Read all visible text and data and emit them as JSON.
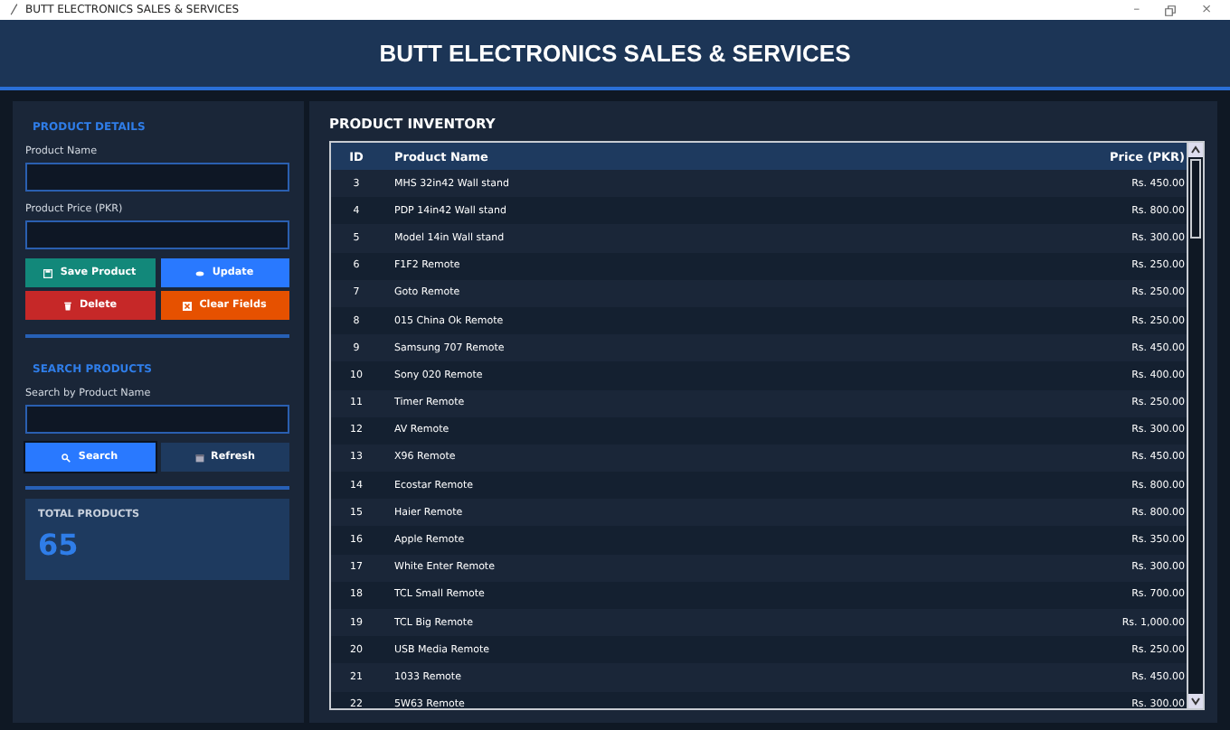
{
  "window": {
    "title": "BUTT ELECTRONICS SALES & SERVICES",
    "controls": [
      "–",
      "×"
    ]
  },
  "header": {
    "title": "BUTT ELECTRONICS SALES & SERVICES"
  },
  "product_details": {
    "title": "PRODUCT DETAILS",
    "fields": [
      {
        "label": "Product Name"
      },
      {
        "label": "Product Price (PKR)"
      }
    ],
    "buttons": [
      {
        "label": "Save Product",
        "kind": "save"
      },
      {
        "label": "Update",
        "kind": "update"
      },
      {
        "label": "Delete",
        "kind": "delete"
      },
      {
        "label": "Clear Fields",
        "kind": "clear"
      }
    ]
  },
  "search_products": {
    "title": "SEARCH PRODUCTS",
    "field": {
      "label": "Search by Product Name"
    },
    "buttons": [
      {
        "label": "Search",
        "kind": "search"
      },
      {
        "label": "Refresh",
        "kind": "refresh"
      }
    ]
  },
  "total_products": {
    "label": "TOTAL PRODUCTS",
    "value": "65"
  },
  "inventory": {
    "title": "PRODUCT INVENTORY",
    "columns": [
      "ID",
      "Product Name",
      "Price (PKR)"
    ],
    "rows": [
      [
        "3",
        "MHS 32in42 Wall stand",
        "Rs. 450.00"
      ],
      [
        "4",
        "PDP 14in42 Wall stand",
        "Rs. 800.00"
      ],
      [
        "5",
        "Model 14in Wall stand",
        "Rs. 300.00"
      ],
      [
        "6",
        "F1F2 Remote",
        "Rs. 250.00"
      ],
      [
        "7",
        "Goto Remote",
        "Rs. 250.00"
      ],
      [
        "8",
        "015 China Ok Remote",
        "Rs. 250.00"
      ],
      [
        "9",
        "Samsung 707 Remote",
        "Rs. 450.00"
      ],
      [
        "10",
        "Sony 020 Remote",
        "Rs. 400.00"
      ],
      [
        "11",
        "Timer Remote",
        "Rs. 250.00"
      ],
      [
        "12",
        "AV Remote",
        "Rs. 300.00"
      ],
      [
        "13",
        "X96 Remote",
        "Rs. 450.00"
      ],
      [
        "14",
        "Ecostar Remote",
        "Rs. 800.00"
      ],
      [
        "15",
        "Haier Remote",
        "Rs. 800.00"
      ],
      [
        "16",
        "Apple Remote",
        "Rs. 350.00"
      ],
      [
        "17",
        "White Enter Remote",
        "Rs. 300.00"
      ],
      [
        "18",
        "TCL Small Remote",
        "Rs. 700.00"
      ],
      [
        "19",
        "TCL Big Remote",
        "Rs. 1,000.00"
      ],
      [
        "20",
        "USB Media Remote",
        "Rs. 250.00"
      ],
      [
        "21",
        "1033 Remote",
        "Rs. 450.00"
      ],
      [
        "22",
        "5W63 Remote",
        "Rs. 300.00"
      ]
    ]
  }
}
